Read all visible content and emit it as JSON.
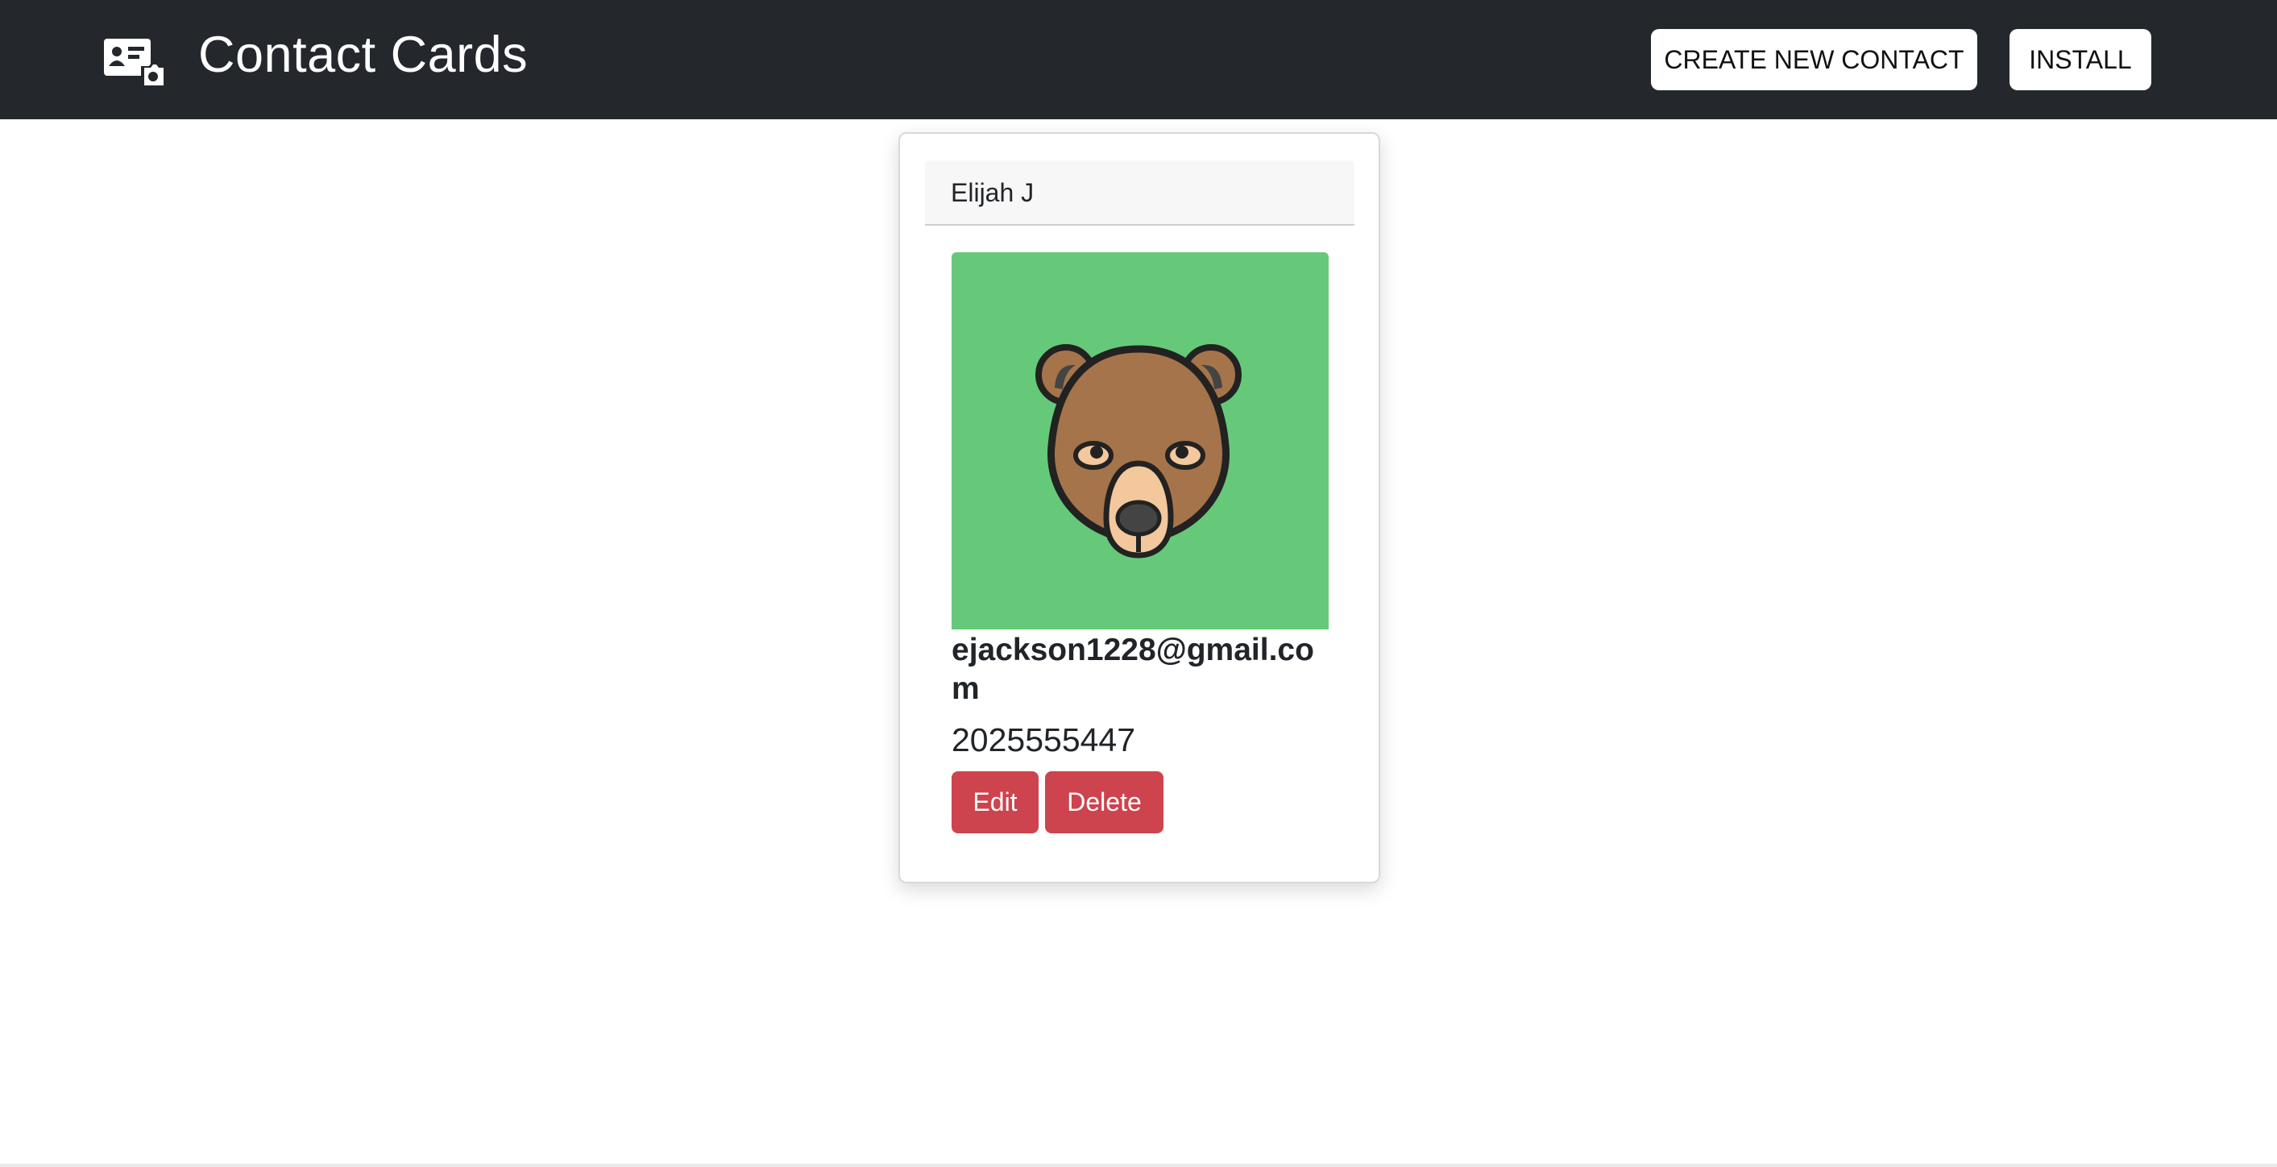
{
  "header": {
    "app_icon": "contact-card-icon",
    "title": "Contact Cards",
    "create_label": "CREATE NEW CONTACT",
    "install_label": "INSTALL",
    "background": "#24272c"
  },
  "contacts": [
    {
      "name": "Elijah J",
      "avatar": "bear-avatar-icon",
      "avatar_background": "#66c979",
      "email": "ejackson1228@gmail.com",
      "phone": "2025555447",
      "edit_label": "Edit",
      "delete_label": "Delete"
    }
  ],
  "colors": {
    "danger": "#cd444e"
  }
}
